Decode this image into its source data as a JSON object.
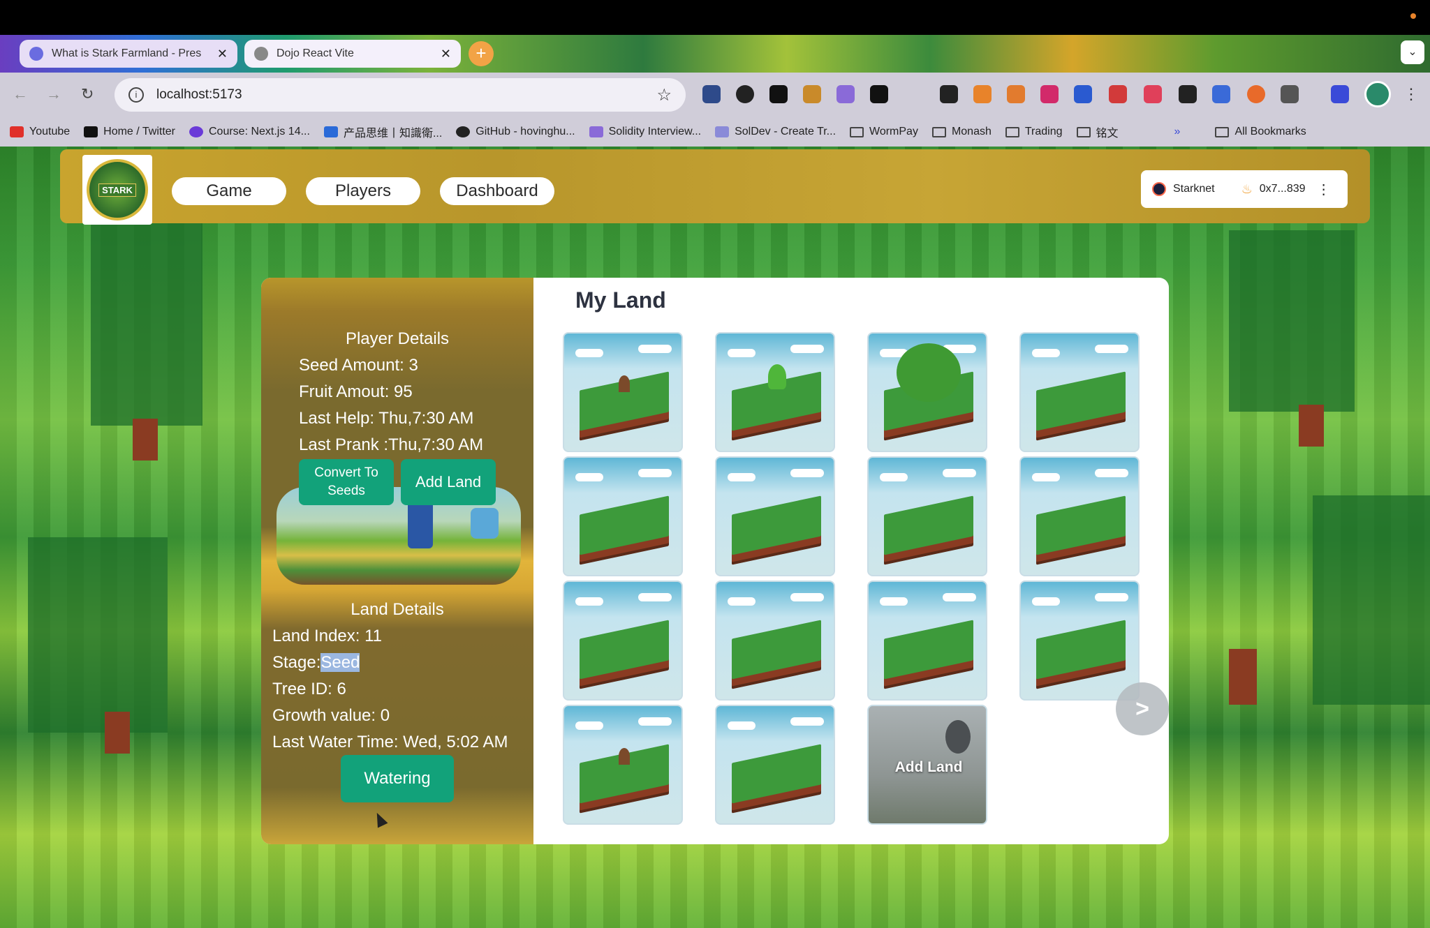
{
  "browser": {
    "tabs": [
      {
        "title": "What is Stark Farmland - Pres",
        "favicon_color": "#6a6ce0"
      },
      {
        "title": "Dojo React Vite",
        "favicon_color": "#888888"
      }
    ],
    "url": "localhost:5173",
    "bookmarks": [
      {
        "label": "Youtube",
        "icon": "youtube-icon"
      },
      {
        "label": "Home / Twitter",
        "icon": "x-icon"
      },
      {
        "label": "Course: Next.js 14...",
        "icon": "course-icon"
      },
      {
        "label": "产品思维丨知識衛...",
        "icon": "product-icon"
      },
      {
        "label": "GitHub - hovinghu...",
        "icon": "github-icon"
      },
      {
        "label": "Solidity Interview...",
        "icon": "r-icon"
      },
      {
        "label": "SolDev - Create Tr...",
        "icon": "soldev-icon"
      },
      {
        "label": "WormPay",
        "icon": "folder-icon"
      },
      {
        "label": "Monash",
        "icon": "folder-icon"
      },
      {
        "label": "Trading",
        "icon": "folder-icon"
      },
      {
        "label": "铭文",
        "icon": "folder-icon"
      }
    ],
    "overflow": "»",
    "all_bookmarks": "All Bookmarks"
  },
  "nav": {
    "logo_text": "STARK",
    "links": [
      "Game",
      "Players",
      "Dashboard"
    ],
    "wallet": {
      "network": "Starknet",
      "address": "0x7...839"
    }
  },
  "player": {
    "heading": "Player Details",
    "seed_amount": "Seed Amount: 3",
    "fruit_amount": "Fruit Amout: 95",
    "last_help": "Last Help: Thu,7:30 AM",
    "last_prank": "Last Prank :Thu,7:30 AM",
    "convert_btn": "Convert To Seeds",
    "add_land_btn": "Add Land"
  },
  "land": {
    "heading": "Land Details",
    "land_index": "Land Index: 11",
    "stage_label": "Stage:",
    "stage_value": "Seed",
    "tree_id": "Tree ID: 6",
    "growth": "Growth value: 0",
    "last_water": "Last Water Time: Wed, 5:02 AM",
    "water_btn": "Watering"
  },
  "grid": {
    "title": "My Land",
    "tiles": [
      "seed",
      "sprout",
      "tree",
      "empty",
      "empty",
      "empty",
      "empty",
      "empty",
      "empty",
      "empty",
      "empty",
      "empty",
      "seed",
      "empty",
      "add"
    ],
    "add_label": "Add Land",
    "next": ">"
  }
}
